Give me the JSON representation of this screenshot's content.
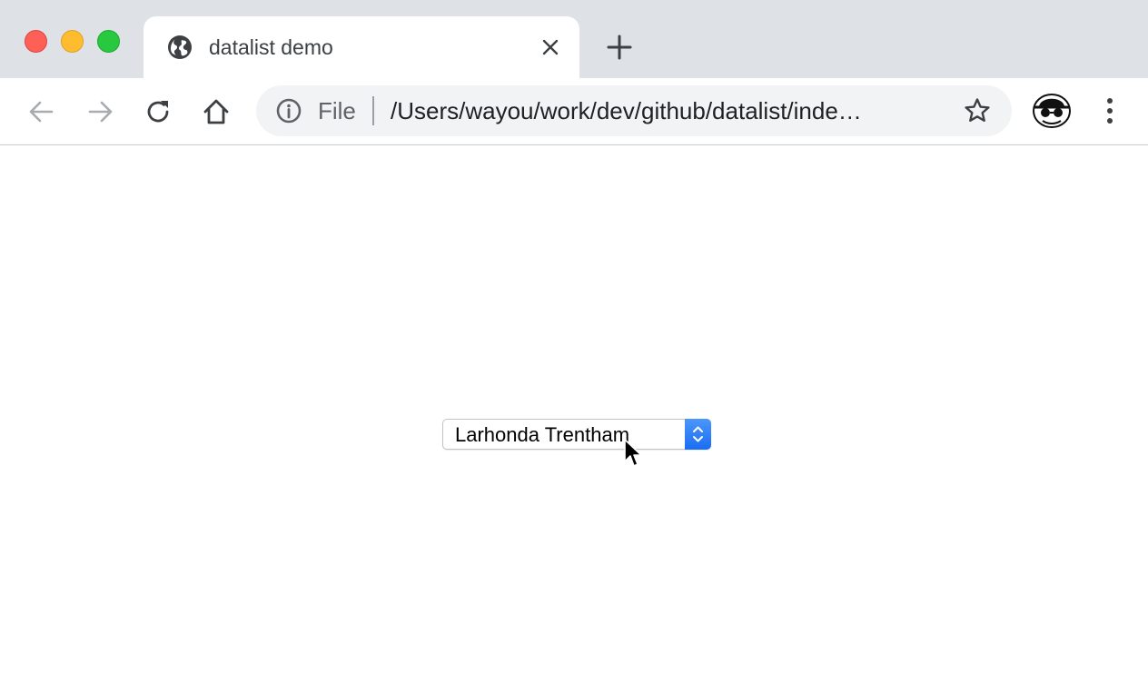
{
  "window": {
    "traffic_lights": [
      "close",
      "minimize",
      "maximize"
    ],
    "colors": {
      "close": "#fe5f57",
      "minimize": "#febc2e",
      "maximize": "#28c840"
    }
  },
  "tab": {
    "title": "datalist demo",
    "favicon": "globe-icon",
    "close_icon": "close-icon"
  },
  "new_tab_icon": "plus-icon",
  "toolbar": {
    "back_icon": "arrow-left-icon",
    "forward_icon": "arrow-right-icon",
    "reload_icon": "reload-icon",
    "home_icon": "home-icon"
  },
  "omnibox": {
    "info_icon": "info-icon",
    "scheme_label": "File",
    "url": "/Users/wayou/work/dev/github/datalist/inde…",
    "star_icon": "star-icon"
  },
  "profile": {
    "avatar": "incognito-avatar-icon"
  },
  "menu_icon": "more-vert-icon",
  "page": {
    "select": {
      "selected_value": "Larhonda Trentham",
      "arrow_icon": "up-down-chevron-icon",
      "accent_color": "#2a7af6"
    }
  }
}
